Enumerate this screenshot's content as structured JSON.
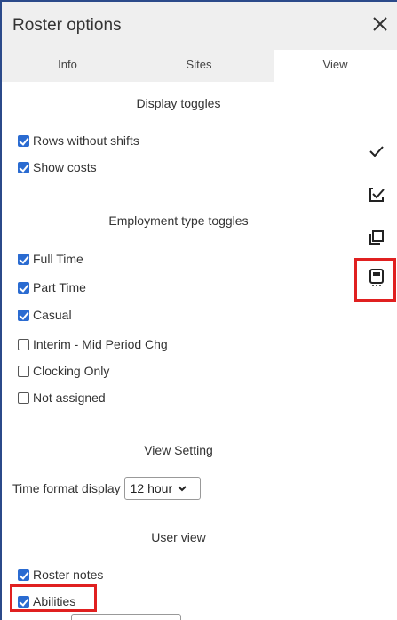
{
  "window": {
    "title": "Roster options"
  },
  "tabs": [
    {
      "label": "Info"
    },
    {
      "label": "Sites"
    },
    {
      "label": "View"
    }
  ],
  "display_toggles": {
    "title": "Display toggles",
    "items": [
      {
        "label": "Rows without shifts",
        "checked": true
      },
      {
        "label": "Show costs",
        "checked": true
      }
    ]
  },
  "employment_toggles": {
    "title": "Employment type toggles",
    "items": [
      {
        "label": "Full Time",
        "checked": true
      },
      {
        "label": "Part Time",
        "checked": true
      },
      {
        "label": "Casual",
        "checked": true
      },
      {
        "label": "Interim - Mid Period Chg",
        "checked": false
      },
      {
        "label": "Clocking Only",
        "checked": false
      },
      {
        "label": "Not assigned",
        "checked": false
      }
    ]
  },
  "view_setting": {
    "title": "View Setting",
    "time_format_label": "Time format display",
    "time_format_value": "12 hour"
  },
  "user_view": {
    "title": "User view",
    "items": [
      {
        "label": "Roster notes",
        "checked": true
      },
      {
        "label": "Abilities",
        "checked": true
      }
    ]
  },
  "sidebar": {
    "actions": [
      {
        "icon": "check-icon"
      },
      {
        "icon": "select-all-icon"
      },
      {
        "icon": "copy-icon"
      },
      {
        "icon": "save-icon"
      }
    ]
  },
  "highlight_color": "#e02020",
  "accent_color": "#2a6bd1"
}
